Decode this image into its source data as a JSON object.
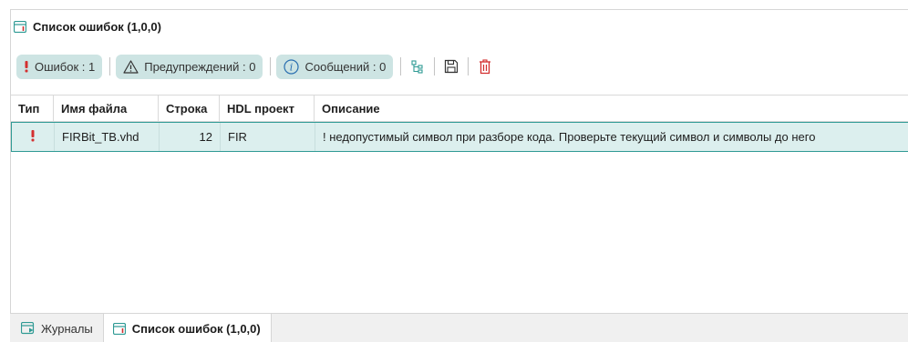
{
  "panel": {
    "title": "Список ошибок (1,0,0)"
  },
  "toolbar": {
    "errors_label": "Ошибок : 1",
    "warnings_label": "Предупреждений : 0",
    "messages_label": "Сообщений : 0"
  },
  "grid": {
    "columns": [
      "Тип",
      "Имя файла",
      "Строка",
      "HDL проект",
      "Описание"
    ],
    "rows": [
      {
        "type_icon": "!",
        "file": "FIRBit_TB.vhd",
        "line": "12",
        "project": "FIR",
        "description": "! недопустимый символ при разборе кода. Проверьте текущий символ и символы до него"
      }
    ]
  },
  "tabs": [
    {
      "label": "Журналы"
    },
    {
      "label": "Список ошибок (1,0,0)"
    }
  ],
  "colors": {
    "accent": "#2f9a94",
    "filter_bg": "#cde4e3",
    "selected_row_bg": "#dcefee",
    "error_red": "#d32f2f"
  },
  "icons": {
    "title": "window-list-icon",
    "error": "exclamation-icon",
    "warning": "warning-triangle-icon",
    "info": "info-circle-icon",
    "tree": "hierarchy-icon",
    "save": "save-icon",
    "delete": "trash-icon",
    "journals_tab": "journal-icon"
  }
}
